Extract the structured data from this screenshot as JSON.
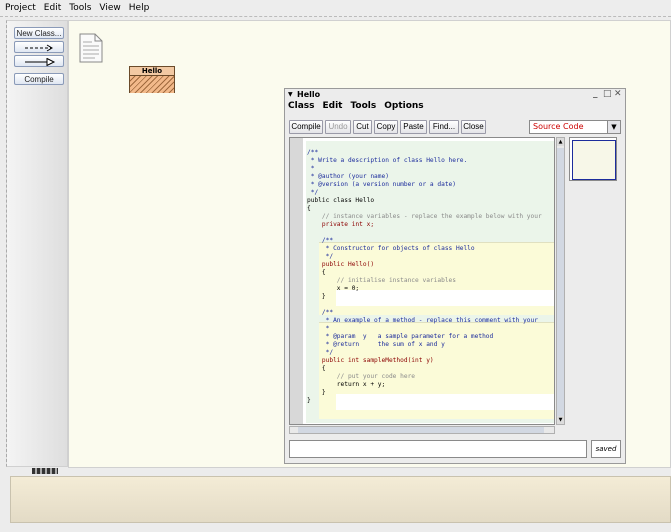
{
  "menubar": {
    "items": [
      "Project",
      "Edit",
      "Tools",
      "View",
      "Help"
    ]
  },
  "left_panel": {
    "new_class": "New Class...",
    "compile": "Compile"
  },
  "diagram": {
    "class_name": "Hello"
  },
  "editor": {
    "title": "Hello",
    "window_controls": {
      "minimize": "_",
      "maximize": "□",
      "close": "✕"
    },
    "menu": [
      "Class",
      "Edit",
      "Tools",
      "Options"
    ],
    "toolbar": {
      "compile": "Compile",
      "undo": "Undo",
      "cut": "Cut",
      "copy": "Copy",
      "paste": "Paste",
      "find": "Find...",
      "close": "Close"
    },
    "view_select": "Source Code",
    "status": "saved",
    "code": [
      "/**",
      " * Write a description of class Hello here.",
      " *",
      " * @author (your name)",
      " * @version (a version number or a date)",
      " */",
      "public class Hello",
      "{",
      "    // instance variables - replace the example below with your",
      "    private int x;",
      "",
      "    /**",
      "     * Constructor for objects of class Hello",
      "     */",
      "    public Hello()",
      "    {",
      "        // initialise instance variables",
      "        x = 0;",
      "    }",
      "",
      "    /**",
      "     * An example of a method - replace this comment with your",
      "     *",
      "     * @param  y   a sample parameter for a method",
      "     * @return     the sum of x and y",
      "     */",
      "    public int sampleMethod(int y)",
      "    {",
      "        // put your code here",
      "        return x + y;",
      "    }",
      "}"
    ]
  }
}
